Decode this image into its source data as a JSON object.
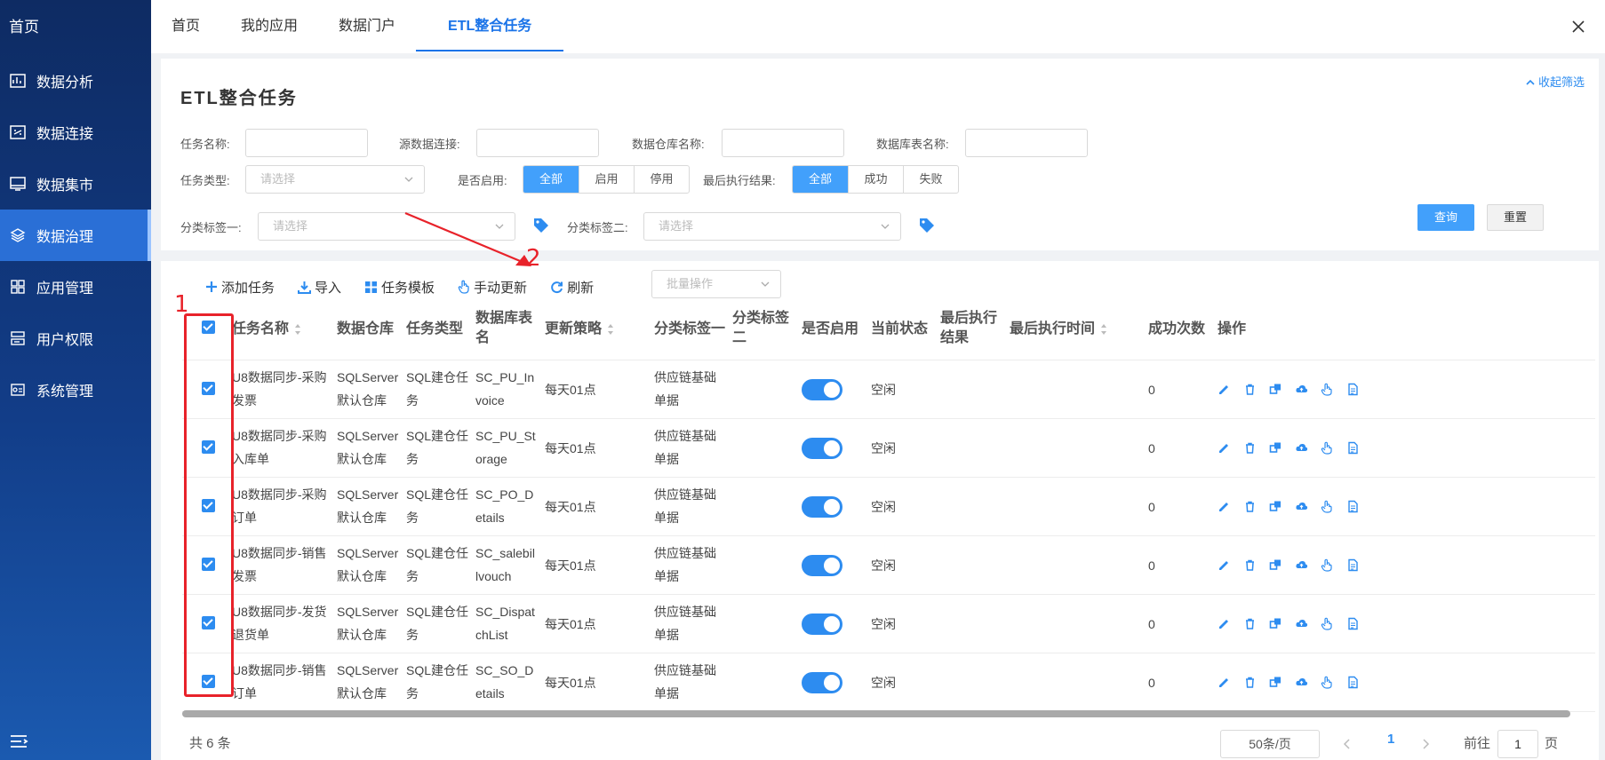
{
  "sidebar": {
    "home": "首页",
    "items": [
      {
        "label": "数据分析",
        "icon": "analysis-icon"
      },
      {
        "label": "数据连接",
        "icon": "connection-icon"
      },
      {
        "label": "数据集市",
        "icon": "mart-icon"
      },
      {
        "label": "数据治理",
        "icon": "governance-icon",
        "active": true
      },
      {
        "label": "应用管理",
        "icon": "apps-icon"
      },
      {
        "label": "用户权限",
        "icon": "users-icon"
      },
      {
        "label": "系统管理",
        "icon": "system-icon"
      }
    ]
  },
  "tabs": [
    {
      "label": "首页"
    },
    {
      "label": "我的应用"
    },
    {
      "label": "数据门户"
    },
    {
      "label": "ETL整合任务",
      "active": true
    }
  ],
  "filter": {
    "title": "ETL整合任务",
    "collapse": "收起筛选",
    "task_name_label": "任务名称:",
    "source_conn_label": "源数据连接:",
    "warehouse_label": "数据仓库名称:",
    "db_table_label": "数据库表名称:",
    "task_type_label": "任务类型:",
    "task_type_placeholder": "请选择",
    "enabled_label": "是否启用:",
    "enabled_options": [
      "全部",
      "启用",
      "停用"
    ],
    "last_result_label": "最后执行结果:",
    "last_result_options": [
      "全部",
      "成功",
      "失败"
    ],
    "tag1_label": "分类标签一:",
    "tag1_placeholder": "请选择",
    "tag2_label": "分类标签二:",
    "tag2_placeholder": "请选择",
    "query": "查询",
    "reset": "重置"
  },
  "toolbar": {
    "add": "添加任务",
    "import": "导入",
    "template": "任务模板",
    "manual_update": "手动更新",
    "refresh": "刷新",
    "batch_placeholder": "批量操作"
  },
  "table": {
    "headers": {
      "name": "任务名称",
      "warehouse": "数据仓库",
      "type": "任务类型",
      "db_table_1": "数据库表",
      "db_table_2": "名",
      "strategy": "更新策略",
      "tag1": "分类标签一",
      "tag2_1": "分类标签",
      "tag2_2": "二",
      "enabled": "是否启用",
      "status": "当前状态",
      "last_result_1": "最后执行",
      "last_result_2": "结果",
      "last_time": "最后执行时间",
      "success_count": "成功次数",
      "ops": "操作"
    },
    "rows": [
      {
        "name1": "U8数据同步-采购",
        "name2": "发票",
        "wh1": "SQLServer",
        "wh2": "默认仓库",
        "type1": "SQL建仓任",
        "type2": "务",
        "tbl1": "SC_PU_In",
        "tbl2": "voice",
        "strategy": "每天01点",
        "tag1a": "供应链基础",
        "tag1b": "单据",
        "status": "空闲",
        "count": "0"
      },
      {
        "name1": "U8数据同步-采购",
        "name2": "入库单",
        "wh1": "SQLServer",
        "wh2": "默认仓库",
        "type1": "SQL建仓任",
        "type2": "务",
        "tbl1": "SC_PU_St",
        "tbl2": "orage",
        "strategy": "每天01点",
        "tag1a": "供应链基础",
        "tag1b": "单据",
        "status": "空闲",
        "count": "0"
      },
      {
        "name1": "U8数据同步-采购",
        "name2": "订单",
        "wh1": "SQLServer",
        "wh2": "默认仓库",
        "type1": "SQL建仓任",
        "type2": "务",
        "tbl1": "SC_PO_D",
        "tbl2": "etails",
        "strategy": "每天01点",
        "tag1a": "供应链基础",
        "tag1b": "单据",
        "status": "空闲",
        "count": "0"
      },
      {
        "name1": "U8数据同步-销售",
        "name2": "发票",
        "wh1": "SQLServer",
        "wh2": "默认仓库",
        "type1": "SQL建仓任",
        "type2": "务",
        "tbl1": "SC_salebil",
        "tbl2": "lvouch",
        "strategy": "每天01点",
        "tag1a": "供应链基础",
        "tag1b": "单据",
        "status": "空闲",
        "count": "0"
      },
      {
        "name1": "U8数据同步-发货",
        "name2": "退货单",
        "wh1": "SQLServer",
        "wh2": "默认仓库",
        "type1": "SQL建仓任",
        "type2": "务",
        "tbl1": "SC_Dispat",
        "tbl2": "chList",
        "strategy": "每天01点",
        "tag1a": "供应链基础",
        "tag1b": "单据",
        "status": "空闲",
        "count": "0"
      },
      {
        "name1": "U8数据同步-销售",
        "name2": "订单",
        "wh1": "SQLServer",
        "wh2": "默认仓库",
        "type1": "SQL建仓任",
        "type2": "务",
        "tbl1": "SC_SO_D",
        "tbl2": "etails",
        "strategy": "每天01点",
        "tag1a": "供应链基础",
        "tag1b": "单据",
        "status": "空闲",
        "count": "0"
      }
    ]
  },
  "pagination": {
    "total": "共 6 条",
    "page_size": "50条/页",
    "current": "1",
    "goto_label": "前往",
    "goto_value": "1",
    "page_label": "页"
  },
  "annotations": {
    "label_1": "1",
    "label_2": "2"
  },
  "colors": {
    "accent": "#2d8cf0",
    "annotation": "#e8222a",
    "sidebar_active": "#2a6fd6"
  }
}
